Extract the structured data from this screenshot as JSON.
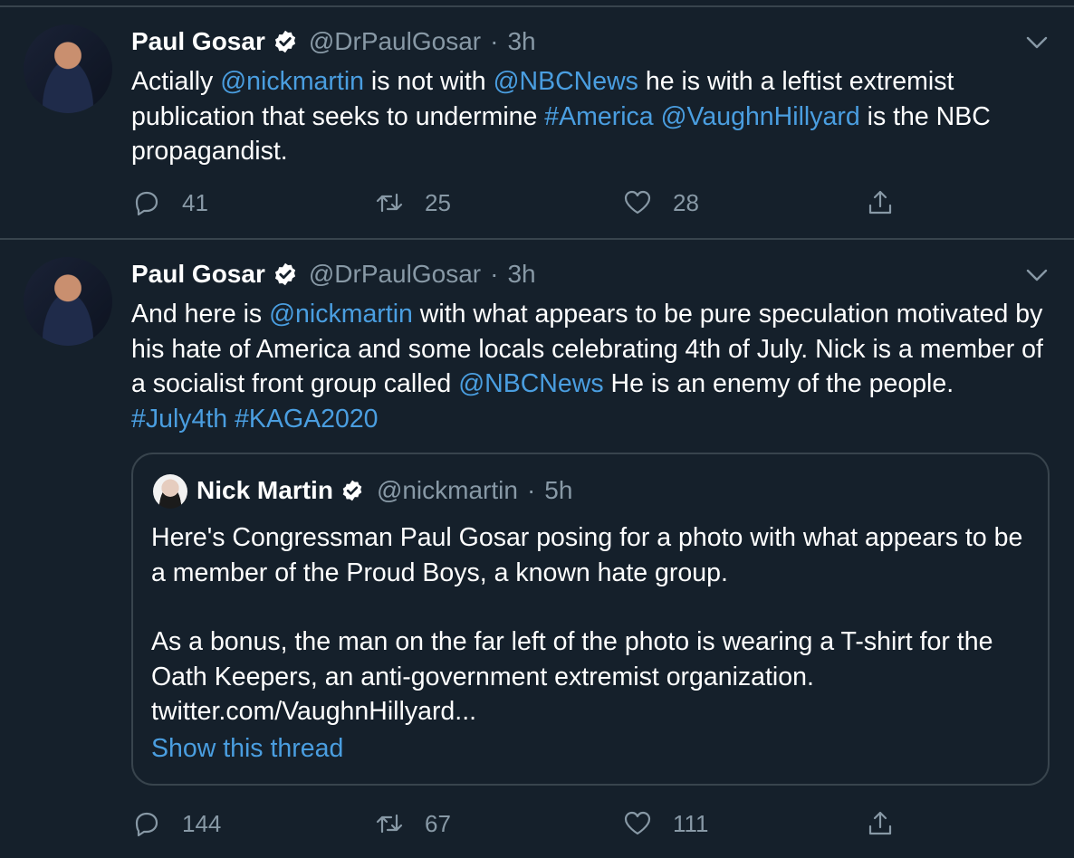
{
  "colors": {
    "background": "#15202b",
    "link": "#4a9ee0",
    "muted": "#8899a6",
    "divider": "#38444d"
  },
  "tweets": [
    {
      "author": {
        "name": "Paul Gosar",
        "handle": "@DrPaulGosar",
        "time": "3h"
      },
      "text": {
        "p1": "Actially ",
        "m1": "@nickmartin",
        "p2": " is not with ",
        "m2": "@NBCNews",
        "p3": " he is with a leftist extremist publication that seeks to undermine ",
        "m3": "#America",
        "p4": " ",
        "m4": "@VaughnHillyard",
        "p5": " is the NBC propagandist."
      },
      "stats": {
        "replies": "41",
        "retweets": "25",
        "likes": "28"
      }
    },
    {
      "author": {
        "name": "Paul Gosar",
        "handle": "@DrPaulGosar",
        "time": "3h"
      },
      "text": {
        "p1": "And here is ",
        "m1": "@nickmartin",
        "p2": " with what appears to be pure speculation motivated by his hate of America and some locals celebrating 4th of July. Nick is a member of a socialist front group called ",
        "m2": "@NBCNews",
        "p3": " He is an enemy of the people.  ",
        "m3": "#July4th",
        "p4": " ",
        "m4": "#KAGA2020"
      },
      "quote": {
        "author": {
          "name": "Nick Martin",
          "handle": "@nickmartin",
          "time": "5h"
        },
        "para1": "Here's Congressman Paul Gosar posing for a photo with what appears to be a member of the Proud Boys, a known hate group.",
        "para2": "As a bonus, the man on the far left of the photo is wearing a T-shirt for the Oath Keepers, an anti-government extremist organization.",
        "link": "twitter.com/VaughnHillyard...",
        "show_thread": "Show this thread"
      },
      "stats": {
        "replies": "144",
        "retweets": "67",
        "likes": "111"
      }
    }
  ],
  "icons": [
    "verified-icon",
    "chevron-down-icon",
    "reply-icon",
    "retweet-icon",
    "like-icon",
    "share-icon"
  ]
}
